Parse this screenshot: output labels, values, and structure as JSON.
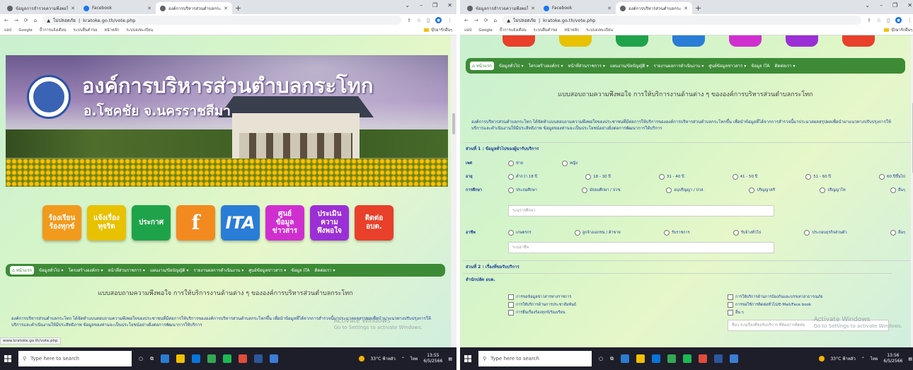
{
  "browser": {
    "tabs": [
      {
        "label": "ข้อมูลการสำรวจความพึงพอใจ"
      },
      {
        "label": "Facebook"
      },
      {
        "label": "องค์การบริหารส่วนตำบลกระโทก"
      }
    ],
    "new_tab": "+",
    "win_controls": [
      "⌄",
      "–",
      "❐",
      "✕"
    ],
    "lock_text": "ไม่ปลอดภัย",
    "url": "kratoke.go.th/vote.php",
    "bookmarks": [
      "แอป",
      "Google",
      "ป้ำการแจ้งเตือน",
      "ระบบยื่นคำขอ",
      "หน้าหลัก",
      "ระบบลงทะเบียน"
    ],
    "bookmark_folder": "บุ๊กมาร์กอื่นๆ",
    "status_url": "www.kratoke.go.th/vote.php"
  },
  "site": {
    "title": "องค์การบริหารส่วนตำบลกระโทก",
    "subtitle": "อ.โชคชัย จ.นครราชสีมา",
    "icons": [
      {
        "label": "ร้องเรียน\nร้องทุกข์",
        "color": "#f19a1d"
      },
      {
        "label": "แจ้งเรื่อง\nทุจริต",
        "color": "#e8c100"
      },
      {
        "label": "ประกาศ",
        "color": "#1fa34a"
      },
      {
        "label": "f",
        "color": "#f28a20"
      },
      {
        "label": "ITA",
        "color": "#2a7dd6"
      },
      {
        "label": "ศูนย์\nข้อมูล\nข่าวสาร",
        "color": "#d02fd0"
      },
      {
        "label": "ประเมิน\nความ\nพึงพอใจ",
        "color": "#9b2fd6"
      },
      {
        "label": "ติดต่อ\nอบต.",
        "color": "#e8402a"
      }
    ],
    "nav": [
      "หน้าแรก",
      "ข้อมูลทั่วไป",
      "โครงสร้างองค์กร",
      "หน้าที่ส่วนราชการ",
      "แผนงาน/ข้อบัญญัติ",
      "รายงานผลการดำเนินงาน",
      "ศูนย์ข้อมูลข่าวสาร",
      "ข้อมูล ITA",
      "ติดต่อเรา"
    ],
    "page_title": "แบบสอบถามความพึงพอใจ การให้บริการงานด้านต่าง ๆ ขององค์การบริหารส่วนตำบลกระโทก",
    "intro": "องค์การบริหารส่วนตำบลกระโทก ได้จัดทำแบบสอบถามความพึงพอใจของประชาชนที่มีต่อการให้บริการขององค์การบริหารส่วนตำบลกระโทกขึ้น เพื่อนำข้อมูลที่ได้จากการสำรวจนี้มาประมวลผลสรุปผลเพื่อนำมาแนวทางปรับปรุงการให้บริการและดำเนินงานให้มีประสิทธิภาพ ข้อมูลของท่านจะเป็นประโยชน์อย่างยิ่งต่อการพัฒนาการให้บริการ"
  },
  "form": {
    "section1": "ส่วนที่ 1 : ข้อมูลทั่วไปของผู้มารับบริการ",
    "gender": {
      "label": "เพศ",
      "options": [
        "ชาย",
        "หญิง"
      ]
    },
    "age": {
      "label": "อายุ",
      "options": [
        "ต่ำกว่า 18 ปี",
        "18 - 30 ปี",
        "31 - 40 ปี",
        "41 - 50 ปี",
        "51 - 60 ปี",
        "60 ปีขึ้นไป"
      ]
    },
    "edu": {
      "label": "การศึกษา",
      "options": [
        "ประถมศึกษา",
        "มัธยมศึกษา / ปวช.",
        "อนุปริญญา / ปวส.",
        "ปริญญาตรี",
        "ปริญญาโท",
        "อื่นๆ"
      ],
      "placeholder": "ระบุการศึกษา"
    },
    "job": {
      "label": "อาชีพ",
      "options": [
        "เกษตรกร",
        "ลูกจ้างเอกชน / ค้าขาย",
        "รับราชการ",
        "รับจ้างทั่วไป",
        "ประกอบธุรกิจส่วนตัว",
        "อื่นๆ"
      ],
      "placeholder": "ระบุอาชีพ"
    },
    "section2": "ส่วนที่ 2 : เรื่องที่ขอรับบริการ",
    "sub": "สำนักปลัด อบต.",
    "services_left": [
      "การขอข้อมูลข่าวสารทางราชการ",
      "การให้บริการด้านการประชาสัมพันธ์",
      "การยื่นเรื่องร้องทุกข์/ร้องเรียน"
    ],
    "services_right": [
      "การให้บริการด้านการป้องกันและบรรเทาสาธารณภัย",
      "การขอใช้การติดต่อทั่วไป/E-Mail/Face book",
      "อื่น ๆ"
    ],
    "other_placeholder": "อื่นๆ ระบุเรื่องที่ขอรับบริการ ที่ต้องการติดต่อ"
  },
  "windows_notice": {
    "title": "Activate Windows",
    "body": "Go to Settings to activate Windows."
  },
  "taskbar": {
    "search_placeholder": "Type here to search",
    "weather": "33°C ฟ้าหลัว",
    "lang": "ไทย",
    "left_time": "13:55",
    "right_time": "13:56",
    "date": "6/5/2566"
  }
}
